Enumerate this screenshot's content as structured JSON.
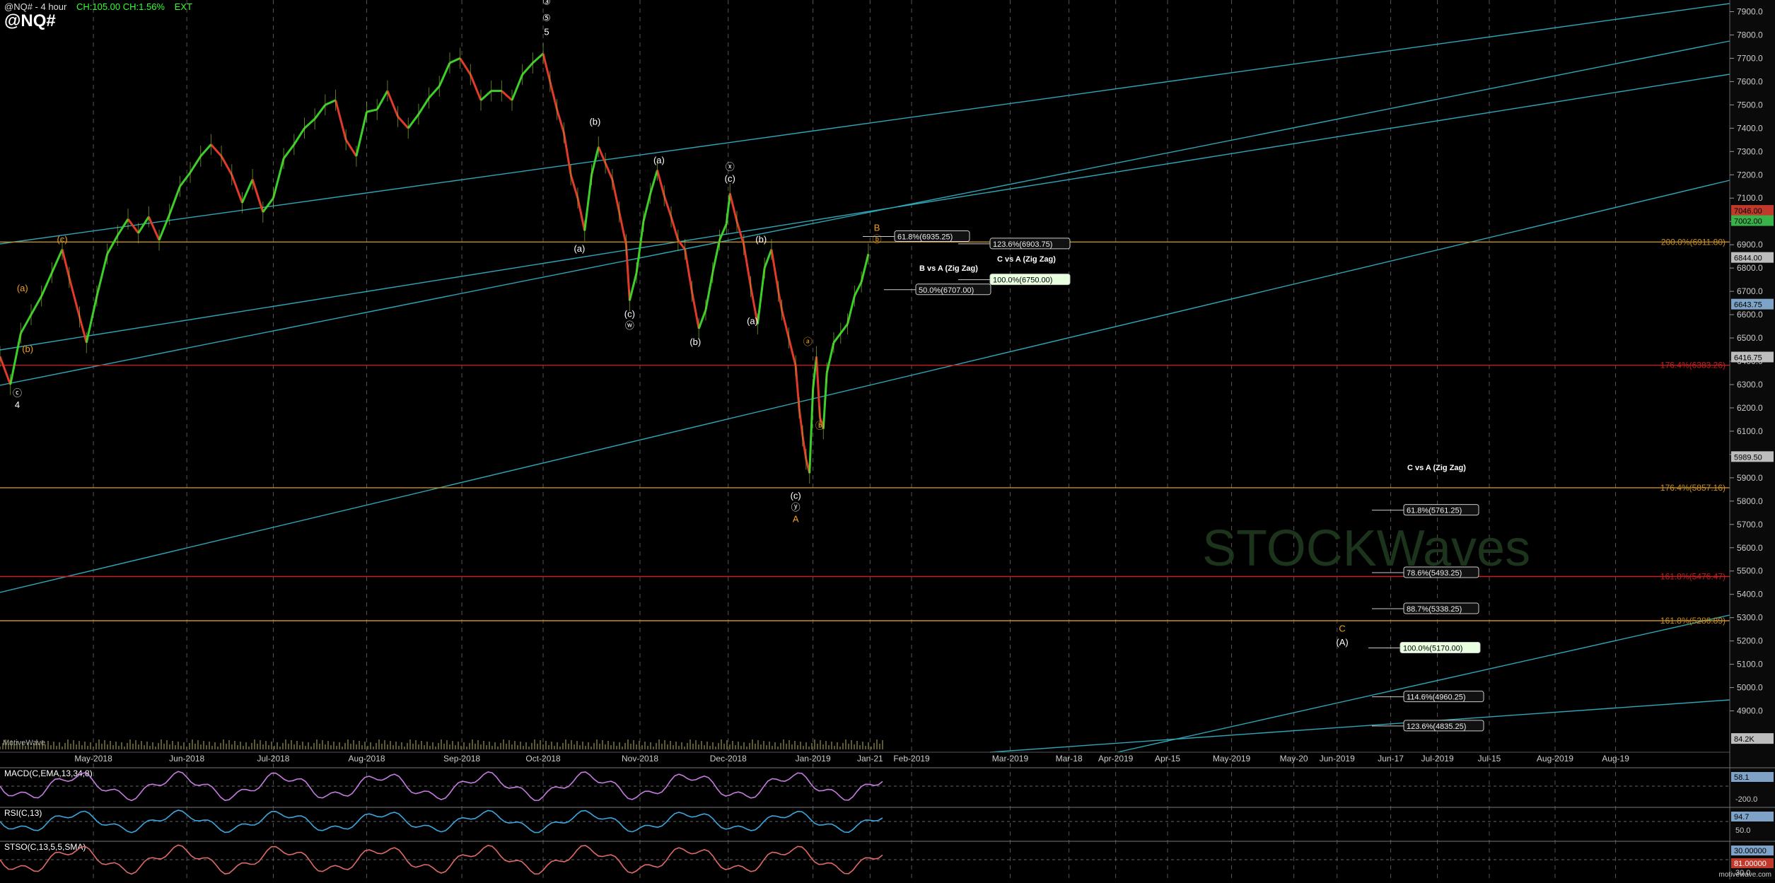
{
  "header": {
    "title": "@NQ# - 4 hour",
    "change": "CH:105.00 CH:1.56%",
    "session": "EXT",
    "symbol": "@NQ#"
  },
  "colors": {
    "up": "#3ccf2a",
    "down": "#e23a2a",
    "fib_orange": "#c8901e",
    "fib_red": "#c81e1e",
    "trend": "#2fa6b8",
    "grid": "#7a7a7a",
    "macd": "#c67be0",
    "rsi": "#3aa8e0",
    "stoch": "#e06a6a"
  },
  "chart_data": [
    {
      "type": "line",
      "panel": "price",
      "title": "@NQ# - 4 hour",
      "ylim": [
        4750,
        7950
      ],
      "y_ticks": [
        4900,
        5000,
        5100,
        5200,
        5300,
        5400,
        5500,
        5600,
        5700,
        5800,
        5900,
        6000,
        6100,
        6200,
        6300,
        6400,
        6500,
        6600,
        6700,
        6800,
        6900,
        7000,
        7100,
        7200,
        7300,
        7400,
        7500,
        7600,
        7700,
        7800,
        7900
      ],
      "x_tick_labels": [
        "May-2018",
        "Jun-2018",
        "Jul-2018",
        "Aug-2018",
        "Sep-2018",
        "Oct-2018",
        "Nov-2018",
        "Dec-2018",
        "Jan-2019",
        "Jan-21",
        "Feb-2019",
        "Mar-2019",
        "Mar-18",
        "Apr-2019",
        "Apr-15",
        "May-2019",
        "May-20",
        "Jun-2019",
        "Jun-17",
        "Jul-2019",
        "Jul-15",
        "Aug-2019",
        "Aug-19"
      ],
      "x_tick_positions": [
        0.054,
        0.108,
        0.158,
        0.212,
        0.267,
        0.314,
        0.37,
        0.421,
        0.47,
        0.503,
        0.527,
        0.584,
        0.618,
        0.645,
        0.675,
        0.712,
        0.748,
        0.773,
        0.804,
        0.831,
        0.861,
        0.899,
        0.934
      ],
      "price_path": [
        [
          0,
          6420
        ],
        [
          0.006,
          6300
        ],
        [
          0.012,
          6520
        ],
        [
          0.018,
          6600
        ],
        [
          0.024,
          6680
        ],
        [
          0.03,
          6780
        ],
        [
          0.036,
          6880
        ],
        [
          0.04,
          6760
        ],
        [
          0.046,
          6590
        ],
        [
          0.05,
          6480
        ],
        [
          0.056,
          6680
        ],
        [
          0.062,
          6860
        ],
        [
          0.068,
          6940
        ],
        [
          0.074,
          7010
        ],
        [
          0.08,
          6950
        ],
        [
          0.086,
          7020
        ],
        [
          0.092,
          6920
        ],
        [
          0.098,
          7030
        ],
        [
          0.104,
          7150
        ],
        [
          0.11,
          7210
        ],
        [
          0.116,
          7280
        ],
        [
          0.122,
          7330
        ],
        [
          0.128,
          7280
        ],
        [
          0.134,
          7200
        ],
        [
          0.14,
          7080
        ],
        [
          0.146,
          7180
        ],
        [
          0.152,
          7040
        ],
        [
          0.158,
          7100
        ],
        [
          0.164,
          7270
        ],
        [
          0.17,
          7330
        ],
        [
          0.176,
          7400
        ],
        [
          0.182,
          7440
        ],
        [
          0.188,
          7500
        ],
        [
          0.194,
          7520
        ],
        [
          0.2,
          7350
        ],
        [
          0.206,
          7280
        ],
        [
          0.212,
          7470
        ],
        [
          0.218,
          7480
        ],
        [
          0.224,
          7560
        ],
        [
          0.23,
          7450
        ],
        [
          0.236,
          7400
        ],
        [
          0.242,
          7460
        ],
        [
          0.248,
          7530
        ],
        [
          0.254,
          7580
        ],
        [
          0.26,
          7680
        ],
        [
          0.266,
          7700
        ],
        [
          0.272,
          7630
        ],
        [
          0.278,
          7520
        ],
        [
          0.284,
          7560
        ],
        [
          0.29,
          7560
        ],
        [
          0.296,
          7520
        ],
        [
          0.302,
          7630
        ],
        [
          0.308,
          7680
        ],
        [
          0.314,
          7720
        ],
        [
          0.318,
          7600
        ],
        [
          0.322,
          7480
        ],
        [
          0.326,
          7380
        ],
        [
          0.33,
          7200
        ],
        [
          0.334,
          7100
        ],
        [
          0.338,
          6960
        ],
        [
          0.342,
          7200
        ],
        [
          0.346,
          7320
        ],
        [
          0.35,
          7250
        ],
        [
          0.354,
          7180
        ],
        [
          0.358,
          7040
        ],
        [
          0.362,
          6900
        ],
        [
          0.364,
          6660
        ],
        [
          0.368,
          6780
        ],
        [
          0.372,
          7000
        ],
        [
          0.376,
          7120
        ],
        [
          0.38,
          7220
        ],
        [
          0.384,
          7110
        ],
        [
          0.388,
          7020
        ],
        [
          0.392,
          6920
        ],
        [
          0.396,
          6880
        ],
        [
          0.4,
          6700
        ],
        [
          0.404,
          6540
        ],
        [
          0.408,
          6620
        ],
        [
          0.412,
          6780
        ],
        [
          0.416,
          6920
        ],
        [
          0.42,
          6990
        ],
        [
          0.422,
          7120
        ],
        [
          0.426,
          7000
        ],
        [
          0.43,
          6900
        ],
        [
          0.434,
          6720
        ],
        [
          0.438,
          6560
        ],
        [
          0.442,
          6800
        ],
        [
          0.446,
          6880
        ],
        [
          0.45,
          6700
        ],
        [
          0.452,
          6620
        ],
        [
          0.456,
          6500
        ],
        [
          0.46,
          6380
        ],
        [
          0.462,
          6200
        ],
        [
          0.464,
          6080
        ],
        [
          0.466,
          5980
        ],
        [
          0.468,
          5920
        ],
        [
          0.47,
          6280
        ],
        [
          0.472,
          6420
        ],
        [
          0.474,
          6160
        ],
        [
          0.476,
          6110
        ],
        [
          0.478,
          6350
        ],
        [
          0.482,
          6480
        ],
        [
          0.486,
          6520
        ],
        [
          0.49,
          6560
        ],
        [
          0.494,
          6680
        ],
        [
          0.498,
          6740
        ],
        [
          0.502,
          6860
        ]
      ],
      "fib_levels": [
        {
          "label": "200.0%(6911.80)",
          "value": 6911.8,
          "color": "orange"
        },
        {
          "label": "176.4%(6383.26)",
          "value": 6383.26,
          "color": "red"
        },
        {
          "label": "176.4%(5857.16)",
          "value": 5857.16,
          "color": "orange"
        },
        {
          "label": "161.8%(5476.47)",
          "value": 5476.47,
          "color": "red"
        },
        {
          "label": "161.8%(5286.89)",
          "value": 5286.89,
          "color": "orange"
        }
      ],
      "projection_boxes": [
        {
          "label": "61.8%(6935.25)",
          "value": 6935.25
        },
        {
          "label": "123.6%(6903.75)",
          "value": 6903.75
        },
        {
          "label": "100.0%(6750.00)",
          "value": 6750.0,
          "highlight": true
        },
        {
          "label": "50.0%(6707.00)",
          "value": 6707.0
        },
        {
          "label": "61.8%(5761.25)",
          "value": 5761.25
        },
        {
          "label": "78.6%(5493.25)",
          "value": 5493.25
        },
        {
          "label": "88.7%(5338.25)",
          "value": 5338.25
        },
        {
          "label": "100.0%(5170.00)",
          "value": 5170.0,
          "highlight": true
        },
        {
          "label": "114.6%(4960.25)",
          "value": 4960.25
        },
        {
          "label": "123.6%(4835.25)",
          "value": 4835.25
        }
      ],
      "annotations": [
        "C vs A (Zig Zag)",
        "B vs A (Zig Zag)",
        "C vs A (Zig Zag)"
      ],
      "price_tags": [
        {
          "label": "7046.00",
          "value": 7046,
          "bg": "#c0392b"
        },
        {
          "label": "7002.00",
          "value": 7002,
          "bg": "#39b24a"
        },
        {
          "label": "6844.00",
          "value": 6844,
          "bg": "#bdbdbd"
        },
        {
          "label": "6643.75",
          "value": 6643.75,
          "bg": "#7fa3c7"
        },
        {
          "label": "6416.75",
          "value": 6416.75,
          "bg": "#bdbdbd"
        },
        {
          "label": "5989.50",
          "value": 5989.5,
          "bg": "#bdbdbd"
        },
        {
          "label": "84.2K",
          "value": 4780,
          "bg": "#bdbdbd"
        }
      ],
      "wave_labels": [
        {
          "text": "③",
          "x": 0.316,
          "y": 7930,
          "color": "white"
        },
        {
          "text": "⑤",
          "x": 0.316,
          "y": 7860,
          "color": "white"
        },
        {
          "text": "5",
          "x": 0.316,
          "y": 7800,
          "color": "white"
        },
        {
          "text": "(c)",
          "x": 0.036,
          "y": 6910,
          "color": "orange"
        },
        {
          "text": "(a)",
          "x": 0.013,
          "y": 6700,
          "color": "orange"
        },
        {
          "text": "(b)",
          "x": 0.016,
          "y": 6440,
          "color": "orange"
        },
        {
          "text": "ⓒ",
          "x": 0.01,
          "y": 6250,
          "color": "white"
        },
        {
          "text": "4",
          "x": 0.01,
          "y": 6200,
          "color": "white"
        },
        {
          "text": "(b)",
          "x": 0.344,
          "y": 7415,
          "color": "white"
        },
        {
          "text": "(a)",
          "x": 0.335,
          "y": 6870,
          "color": "white"
        },
        {
          "text": "(a)",
          "x": 0.381,
          "y": 7250,
          "color": "white"
        },
        {
          "text": "(c)",
          "x": 0.364,
          "y": 6590,
          "color": "white"
        },
        {
          "text": "ⓦ",
          "x": 0.364,
          "y": 6540,
          "color": "white"
        },
        {
          "text": "(b)",
          "x": 0.402,
          "y": 6470,
          "color": "white"
        },
        {
          "text": "ⓧ",
          "x": 0.422,
          "y": 7220,
          "color": "white"
        },
        {
          "text": "(c)",
          "x": 0.422,
          "y": 7170,
          "color": "white"
        },
        {
          "text": "(b)",
          "x": 0.44,
          "y": 6910,
          "color": "white"
        },
        {
          "text": "(a)",
          "x": 0.435,
          "y": 6560,
          "color": "white"
        },
        {
          "text": "ⓐ",
          "x": 0.467,
          "y": 6470,
          "color": "orange"
        },
        {
          "text": "ⓑ",
          "x": 0.474,
          "y": 6110,
          "color": "orange"
        },
        {
          "text": "(c)",
          "x": 0.46,
          "y": 5810,
          "color": "white"
        },
        {
          "text": "ⓨ",
          "x": 0.46,
          "y": 5760,
          "color": "white"
        },
        {
          "text": "A",
          "x": 0.46,
          "y": 5710,
          "color": "orange"
        },
        {
          "text": "B",
          "x": 0.507,
          "y": 6960,
          "color": "orange"
        },
        {
          "text": "ⓑ",
          "x": 0.507,
          "y": 6910,
          "color": "orange"
        },
        {
          "text": "C",
          "x": 0.776,
          "y": 5240,
          "color": "orange"
        },
        {
          "text": "(A)",
          "x": 0.776,
          "y": 5180,
          "color": "white"
        }
      ]
    },
    {
      "type": "line",
      "panel": "macd",
      "title": "MACD(C,EMA,13,34,8)",
      "ylim": [
        -300,
        200
      ],
      "y_ticks": [
        -200
      ],
      "tag": "58.1"
    },
    {
      "type": "line",
      "panel": "rsi",
      "title": "RSI(C,13)",
      "ylim": [
        0,
        100
      ],
      "y_ticks": [
        50
      ],
      "tag": "94.7"
    },
    {
      "type": "line",
      "panel": "stoch",
      "title": "STSO(C,13,5,5,SMA)",
      "ylim": [
        0,
        100
      ],
      "y_ticks": [
        30
      ],
      "tag": "30.00000",
      "tag2": "81.00000"
    }
  ],
  "panels": {
    "volume_label": "MotiveWave",
    "watermark": "STOCKWaves",
    "brand": "motivewave.com"
  }
}
